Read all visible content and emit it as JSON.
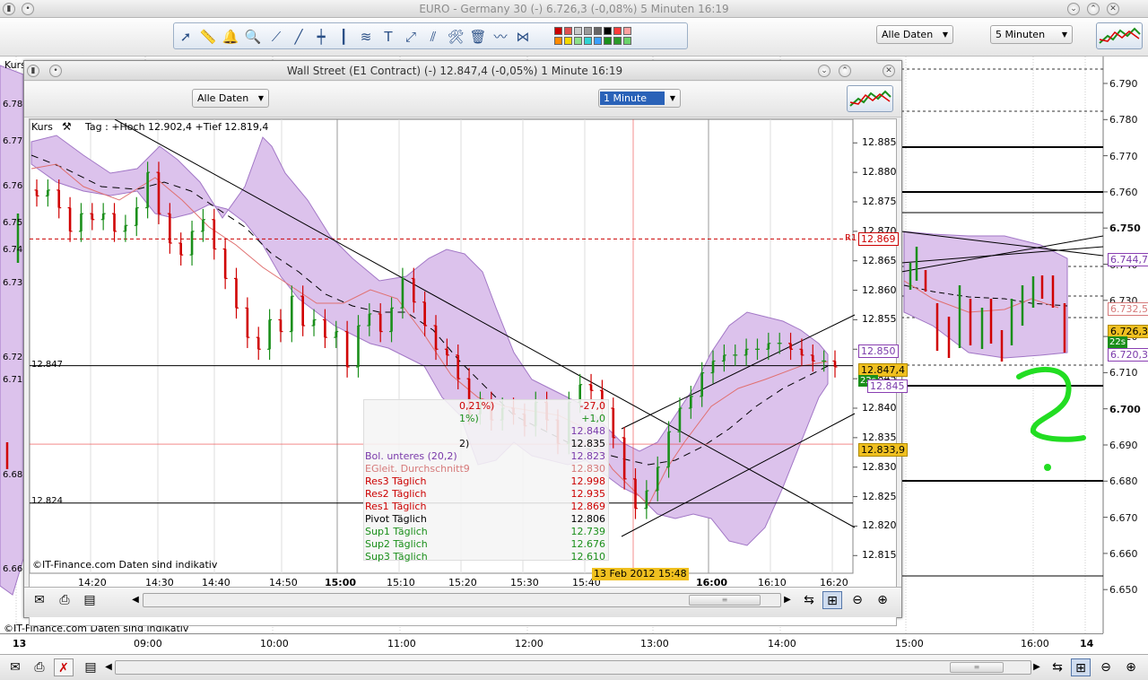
{
  "outer": {
    "title": "EURO - Germany 30 (-)     6.726,3 (-0,08%)     5 Minuten  16:19",
    "combo_data": "Alle Daten",
    "combo_period": "5 Minuten",
    "kurs": "Kurs",
    "watermark": "©IT-Finance.com  Daten sind indikativ",
    "y_ticks": [
      "6.790",
      "6.780",
      "6.770",
      "6.760",
      "6.750",
      "6.740",
      "6.730",
      "6.720",
      "6.710",
      "6.700",
      "6.690",
      "6.680",
      "6.670",
      "6.660",
      "6.650"
    ],
    "left_ticks": [
      "6.78",
      "6.77",
      "6.76",
      "6.75",
      "6.74",
      "6.73",
      "6.72",
      "6.71",
      "6.68",
      "6.66"
    ],
    "x_ticks": [
      "13",
      "09:00",
      "10:00",
      "11:00",
      "12:00",
      "13:00",
      "14:00",
      "15:00",
      "16:00",
      "14"
    ],
    "price_boxes": {
      "upper": "6.744,7",
      "mid": "6.732,5",
      "last": "6.726,3",
      "vol": "22s",
      "lower": "6.720,3"
    },
    "colors": {
      "band": "#dcc2ec",
      "band_edge": "#a277c6",
      "bull": "#1a8f1a",
      "bear": "#d00000",
      "annotation": "#22dd22"
    }
  },
  "inner": {
    "title": "Wall Street (E1 Contract) (-)     12.847,4 (-0,05%)     1 Minute  16:19",
    "combo_data": "Alle Daten",
    "combo_period": "1 Minute",
    "kurs": "Kurs",
    "tag_info": "Tag : +Hoch 12.902,4 +Tief 12.819,4",
    "watermark": "©IT-Finance.com  Daten sind indikativ",
    "y_ticks": [
      "12.885",
      "12.880",
      "12.875",
      "12.870",
      "12.865",
      "12.860",
      "12.855",
      "12.850",
      "12.845",
      "12.840",
      "12.835",
      "12.830",
      "12.825",
      "12.820",
      "12.815"
    ],
    "x_ticks": [
      "14:20",
      "14:30",
      "14:40",
      "14:50",
      "15:00",
      "15:10",
      "15:20",
      "15:30",
      "15:40",
      "16:00",
      "16:10",
      "16:20"
    ],
    "x_bold": "15:00",
    "date_marker": "13 Feb 2012 15:48",
    "r1": "R1",
    "r1_value": "12.869",
    "hline_labels": [
      "12.847",
      "12.824"
    ],
    "price_boxes": {
      "upper": "12.850",
      "last": "12.847,4",
      "vol": "22s",
      "lower": "12.845",
      "cross": "12.833,9"
    },
    "legend": {
      "partial_1": "0,21%)",
      "partial_1_val": "-27,0",
      "partial_2": "1%)",
      "partial_2_val": "+1,0",
      "partial_3_val": "12.848",
      "partial_4": "2)",
      "partial_4_val": "12.835",
      "rows": [
        {
          "label": "Bol. unteres (20,2)",
          "value": "12.823",
          "color": "#7a3aaa"
        },
        {
          "label": "EGleit. Durchschnitt9",
          "value": "12.830",
          "color": "#d67a7a"
        },
        {
          "label": "Res3 Täglich",
          "value": "12.998",
          "color": "#cc0000"
        },
        {
          "label": "Res2 Täglich",
          "value": "12.935",
          "color": "#cc0000"
        },
        {
          "label": "Res1 Täglich",
          "value": "12.869",
          "color": "#cc0000"
        },
        {
          "label": "Pivot Täglich",
          "value": "12.806",
          "color": "#000000"
        },
        {
          "label": "Sup1 Täglich",
          "value": "12.739",
          "color": "#1a8f1a"
        },
        {
          "label": "Sup2 Täglich",
          "value": "12.676",
          "color": "#1a8f1a"
        },
        {
          "label": "Sup3 Täglich",
          "value": "12.610",
          "color": "#1a8f1a"
        }
      ]
    }
  },
  "chart_data": {
    "type": "candlestick",
    "symbol": "Wall Street (E1 Contract)",
    "interval": "1 Minute",
    "last": 12847.4,
    "change_pct": -0.05,
    "day_high": 12902.4,
    "day_low": 12819.4,
    "ylim": [
      12812,
      12889
    ],
    "x_range": [
      "14:13",
      "16:24"
    ],
    "close_series": [
      12876,
      12877,
      12874,
      12870,
      12873,
      12872,
      12873,
      12870,
      12871,
      12874,
      12880,
      12873,
      12868,
      12866,
      12870,
      12872,
      12867,
      12862,
      12857,
      12852,
      12850,
      12855,
      12853,
      12859,
      12854,
      12855,
      12852,
      12853,
      12847,
      12854,
      12856,
      12853,
      12857,
      12862,
      12858,
      12854,
      12850,
      12849,
      12845,
      12839,
      12841,
      12838,
      12840,
      12839,
      12837,
      12841,
      12838,
      12834,
      12841,
      12844,
      12843,
      12840,
      12835,
      12828,
      12823,
      12826,
      12830,
      12836,
      12840,
      12842,
      12846,
      12848,
      12849,
      12849,
      12850,
      12850,
      12851,
      12851,
      12850,
      12849,
      12848,
      12848,
      12847
    ]
  }
}
